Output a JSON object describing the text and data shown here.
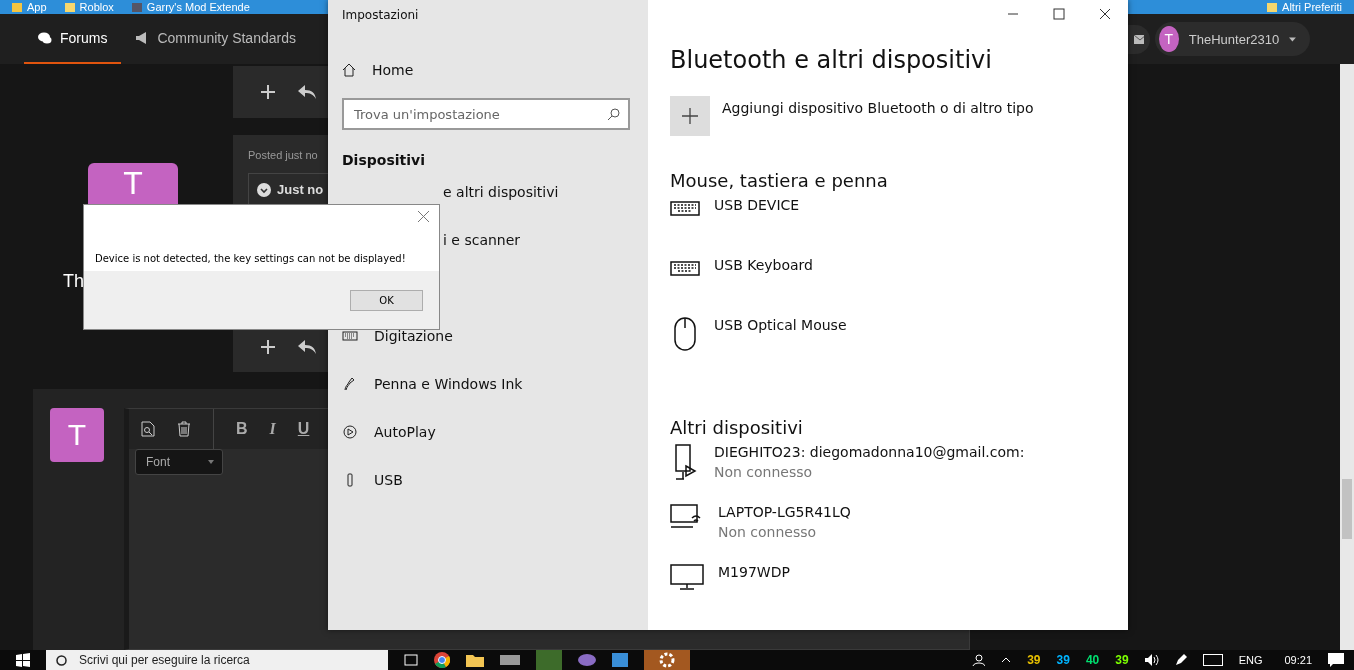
{
  "bookmarks": [
    {
      "label": "App"
    },
    {
      "label": "Roblox"
    },
    {
      "label": "Garry's Mod Extende"
    }
  ],
  "bookmarks_right": "Altri Preferiti",
  "forum_nav": {
    "tabs": [
      {
        "label": "Forums",
        "selected": true
      },
      {
        "label": "Community Standards",
        "selected": false
      }
    ],
    "user": {
      "initial": "T",
      "name": "TheHunter2310"
    }
  },
  "post": {
    "author_initial": "T",
    "author_name": "Th",
    "meta": "Posted just no",
    "quote": "Just no"
  },
  "reply_editor": {
    "avatar_initial": "T",
    "font_select": "Font",
    "format_buttons": [
      {
        "label": "B",
        "kind": "bold"
      },
      {
        "label": "I",
        "kind": "italic"
      },
      {
        "label": "U",
        "kind": "underline"
      }
    ]
  },
  "settings": {
    "title": "Impostazioni",
    "home": "Home",
    "search_placeholder": "Trova un'impostazione",
    "section": "Dispositivi",
    "nav_items": [
      {
        "label": "e altri dispositivi",
        "kind": "covered"
      },
      {
        "label": "i e scanner",
        "kind": "covered"
      },
      {
        "label": "Digitazione",
        "kind": "keyboard"
      },
      {
        "label": "Penna e Windows Ink",
        "kind": "pen"
      },
      {
        "label": "AutoPlay",
        "kind": "autoplay"
      },
      {
        "label": "USB",
        "kind": "usb"
      }
    ],
    "heading": "Bluetooth e altri dispositivi",
    "add_label": "Aggiungi dispositivo Bluetooth o di altro tipo",
    "groups": [
      {
        "title": "Mouse, tastiera e penna",
        "devices": [
          {
            "name": "USB DEVICE",
            "kind": "keyboard"
          },
          {
            "name": "USB Keyboard",
            "kind": "keyboard"
          },
          {
            "name": "USB Optical Mouse",
            "kind": "mouse"
          }
        ]
      },
      {
        "title": "Altri dispositivi",
        "devices": [
          {
            "name": "DIEGHITO23: diegomadonna10@gmail.com:",
            "status": "Non connesso",
            "kind": "phone"
          },
          {
            "name": "LAPTOP-LG5R41LQ",
            "status": "Non connesso",
            "kind": "network"
          },
          {
            "name": "M197WDP",
            "kind": "monitor"
          }
        ]
      }
    ]
  },
  "dialog": {
    "message": "Device is not detected, the key settings can not be displayed!",
    "button": "OK"
  },
  "taskbar": {
    "search_placeholder": "Scrivi qui per eseguire la ricerca",
    "temps": [
      {
        "value": "39",
        "color": "#e8c000"
      },
      {
        "value": "39",
        "color": "#00b4ff"
      },
      {
        "value": "40",
        "color": "#00e070"
      },
      {
        "value": "39",
        "color": "#7cff00"
      }
    ],
    "language": "ENG",
    "time": "09:21"
  }
}
